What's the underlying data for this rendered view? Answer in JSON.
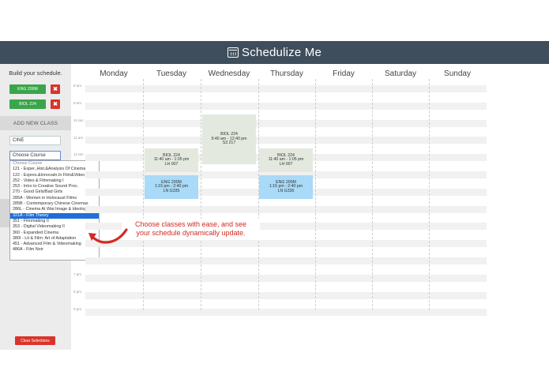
{
  "app": {
    "title": "Schedulize Me",
    "icon": "calendar-icon"
  },
  "sidebar": {
    "build_label": "Build your schedule.",
    "selected_classes": [
      {
        "label": "ENG 200M",
        "remove_icon": "close-icon"
      },
      {
        "label": "BIOL 224",
        "remove_icon": "close-icon"
      }
    ],
    "add_new_label": "ADD NEW CLASS",
    "search_value": "CINE",
    "course_select_value": "Choose Course",
    "course_options": [
      "Choose Course",
      "121 - Exper.,Hist.&Analysis Of Cinema",
      "122 - Expres.&Innovatn.In Film&Video",
      "252 - Video & Filmmaking I",
      "253 - Intro to Creative Sound Proc.",
      "270 - Good Girls/Bad Girls",
      "285A - Women in Holocaust Films",
      "285B - Contemporary Chinese Cinemas",
      "286L - Cinema At War:Image & Ideology",
      "321A - Film Theory",
      "351 - Filmmaking II",
      "353 - Digital Videomaking II",
      "360 - Expanded Cinema",
      "380I - Lit & Film: Art of Adaptation",
      "451 - Advanced Film & Videomaking",
      "486A - Film Noir"
    ],
    "selected_option_index": 9,
    "clear_label": "Clear Selections"
  },
  "calendar": {
    "days": [
      "Monday",
      "Tuesday",
      "Wednesday",
      "Thursday",
      "Friday",
      "Saturday",
      "Sunday"
    ],
    "time_labels": [
      "8 am",
      "9 am",
      "10 am",
      "11 am",
      "12 am",
      "7 pm",
      "8 pm",
      "9 pm"
    ],
    "events": [
      {
        "name": "BIOL 224",
        "time": "9:40 am - 12:40 pm",
        "room": "S3 217",
        "day": "Wednesday",
        "color": "#e4e9df"
      },
      {
        "name": "BIOL 224",
        "time": "11:40 am - 1:05 pm",
        "room": "LH 007",
        "day": "Tuesday",
        "color": "#e4e9df"
      },
      {
        "name": "BIOL 224",
        "time": "11:40 am - 1:05 pm",
        "room": "LH 007",
        "day": "Thursday",
        "color": "#e4e9df"
      },
      {
        "name": "ENG 200M",
        "time": "1:15 pm - 2:40 pm",
        "room": "LN G335",
        "day": "Tuesday",
        "color": "#a9daf7"
      },
      {
        "name": "ENG 200M",
        "time": "1:15 pm - 2:40 pm",
        "room": "LN G335",
        "day": "Thursday",
        "color": "#a9daf7"
      }
    ]
  },
  "callout": {
    "line1": "Choose classes with ease, and see",
    "line2": "your schedule dynamically update.",
    "color": "#d32a24"
  },
  "colors": {
    "header_bg": "#3f4e5c",
    "accent_green": "#3aa54a",
    "accent_red": "#d9342b",
    "select_highlight": "#1e6fd9"
  }
}
